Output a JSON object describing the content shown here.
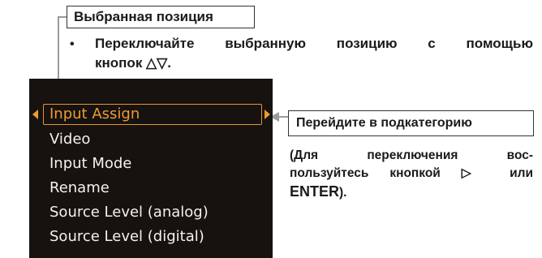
{
  "callouts": {
    "selected_position": "Выбранная позиция",
    "go_to_subcategory": "Перейдите в подкатегорию"
  },
  "instruction": {
    "bullet": "•",
    "line1": "Переключайте выбранную позицию с помощью",
    "line2": "кнопок △▽."
  },
  "note": {
    "line1": "(Для переключения вос-",
    "line2": "пользуйтесь кнопкой ▷ или",
    "line3_big": "ENTER",
    "line3_tail": ")."
  },
  "menu": {
    "items": [
      {
        "label": "Input Assign",
        "selected": true
      },
      {
        "label": "Video"
      },
      {
        "label": "Input Mode"
      },
      {
        "label": "Rename"
      },
      {
        "label": "Source Level (analog)"
      },
      {
        "label": "Source Level (digital)"
      }
    ]
  },
  "colors": {
    "menu_background": "#151210",
    "highlight": "#ee9b36",
    "menu_text": "#f4f1ea",
    "arrow": "#999999"
  }
}
